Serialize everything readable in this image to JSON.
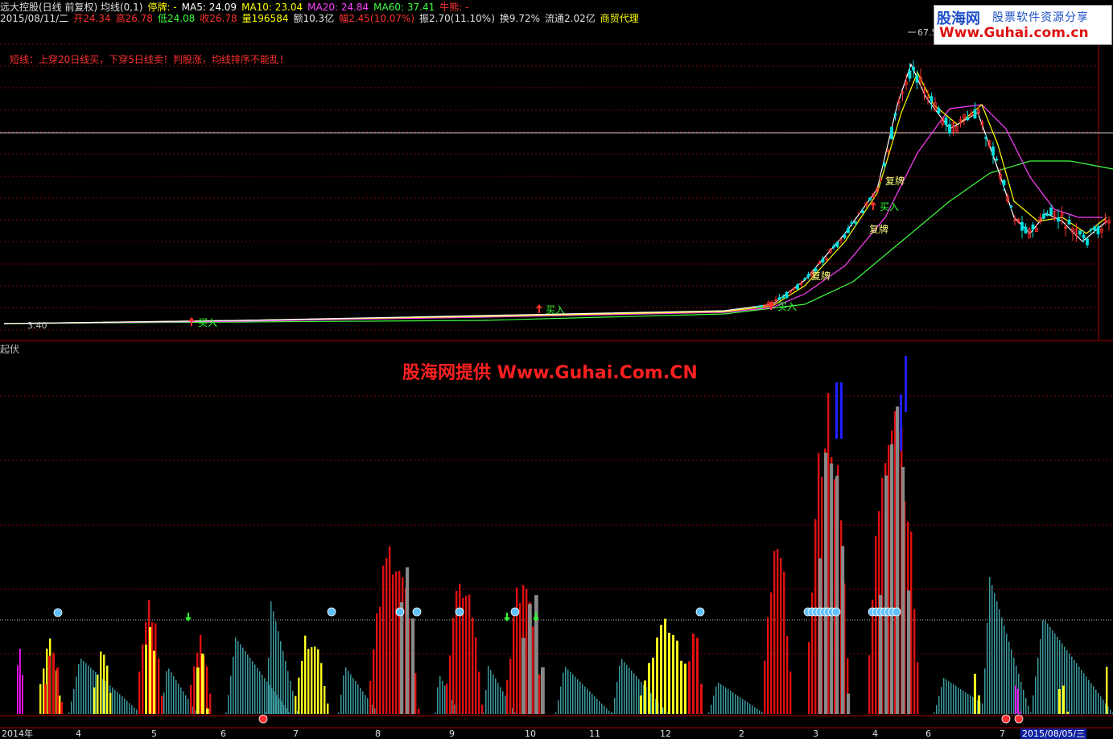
{
  "header": {
    "line1": [
      {
        "text": "远大控股(日线 前复权) 均线(0,1)",
        "color": "#e0e0e0"
      },
      {
        "text": "停牌: -",
        "color": "#ffff00"
      },
      {
        "text": "MA5: 24.09",
        "color": "#ffffff"
      },
      {
        "text": "MA10: 23.04",
        "color": "#ffff00"
      },
      {
        "text": "MA20: 24.84",
        "color": "#ff40ff"
      },
      {
        "text": "MA60: 37.41",
        "color": "#40ff40"
      },
      {
        "text": "牛熊: -",
        "color": "#ff3030"
      }
    ],
    "line2": [
      {
        "text": "2015/08/11/二",
        "color": "#e0e0e0"
      },
      {
        "text": "开24.34",
        "color": "#ff3030"
      },
      {
        "text": "高26.78",
        "color": "#ff3030"
      },
      {
        "text": "低24.08",
        "color": "#40ff40"
      },
      {
        "text": "收26.78",
        "color": "#ff3030"
      },
      {
        "text": "量196584",
        "color": "#ffff00"
      },
      {
        "text": "额10.3亿",
        "color": "#e0e0e0"
      },
      {
        "text": "幅2.45(10.07%)",
        "color": "#ff3030"
      },
      {
        "text": "振2.70(11.10%)",
        "color": "#e0e0e0"
      },
      {
        "text": "换9.72%",
        "color": "#e0e0e0"
      },
      {
        "text": "流通2.02亿",
        "color": "#e0e0e0"
      },
      {
        "text": "商贸代理",
        "color": "#ffff00"
      }
    ]
  },
  "note": "短线：上穿20日线买，下穿5日线卖！判股涨，均线排序不能乱！",
  "sub_title": "起伏",
  "watermark": "股海网提供 Www.Guhai.Com.CN",
  "logo": {
    "brand": "股海网",
    "slogan": "股票软件资源分享",
    "url": "Www.Guhai.com.cn"
  },
  "price_labels": {
    "high": "67.5",
    "low": "3.40"
  },
  "signal_labels": {
    "buy": "买入",
    "resume": "复牌"
  },
  "x_axis": [
    "2014年",
    "4",
    "5",
    "6",
    "7",
    "8",
    "9",
    "10",
    "11",
    "12",
    "2",
    "3",
    "4",
    "6",
    "7"
  ],
  "cursor_date": "2015/08/05/三",
  "colors": {
    "ma5": "#ffffff",
    "ma10": "#ffff00",
    "ma20": "#ff40ff",
    "ma60": "#40ff40",
    "up": "#ff3030",
    "down": "#00e0e0"
  }
}
